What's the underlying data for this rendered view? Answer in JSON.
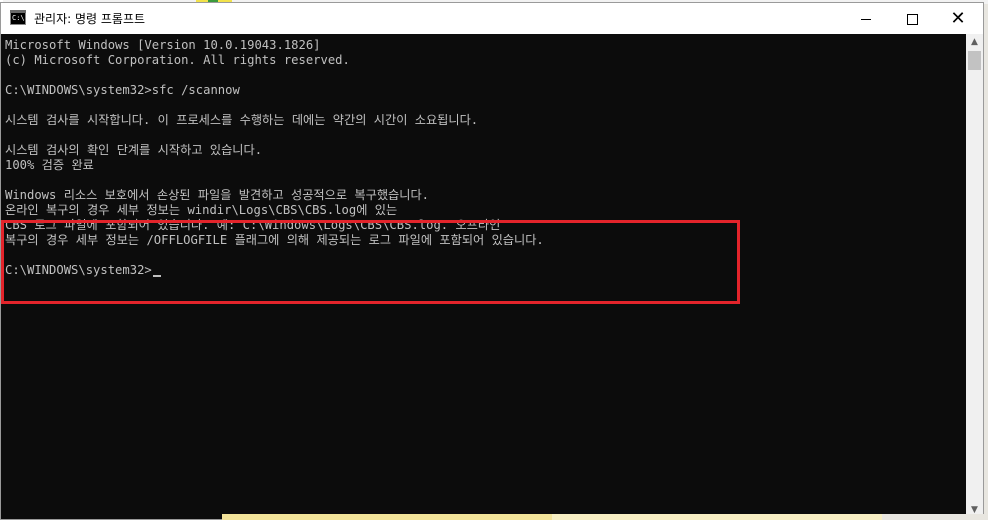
{
  "window": {
    "title": "관리자: 명령 프롬프트",
    "icon_label": "C:\\",
    "minimize_icon": "minimize-icon",
    "maximize_icon": "maximize-icon",
    "close_icon": "close-icon",
    "close_glyph": "✕"
  },
  "console": {
    "lines": [
      "Microsoft Windows [Version 10.0.19043.1826]",
      "(c) Microsoft Corporation. All rights reserved.",
      "",
      "C:\\WINDOWS\\system32>sfc /scannow",
      "",
      "시스템 검사를 시작합니다. 이 프로세스를 수행하는 데에는 약간의 시간이 소요됩니다.",
      "",
      "시스템 검사의 확인 단계를 시작하고 있습니다.",
      "100% 검증 완료",
      "",
      "Windows 리소스 보호에서 손상된 파일을 발견하고 성공적으로 복구했습니다.",
      "온라인 복구의 경우 세부 정보는 windir\\Logs\\CBS\\CBS.log에 있는",
      "CBS 로그 파일에 포함되어 있습니다. 예: C:\\Windows\\Logs\\CBS\\CBS.log. 오프라인",
      "복구의 경우 세부 정보는 /OFFLOGFILE 플래그에 의해 제공되는 로그 파일에 포함되어 있습니다.",
      "",
      "C:\\WINDOWS\\system32>"
    ]
  },
  "scrollbar": {
    "up_glyph": "▲",
    "down_glyph": "▼"
  },
  "colors": {
    "console_bg": "#0c0c0c",
    "console_text": "#c0c0c0",
    "highlight": "#e3242b"
  }
}
